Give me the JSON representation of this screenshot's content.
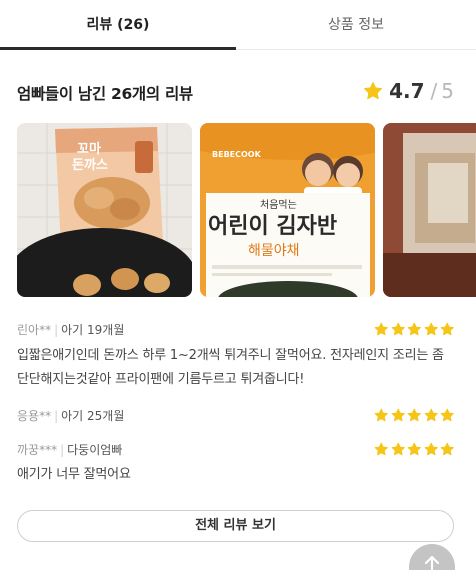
{
  "tabs": {
    "reviews": "리뷰 (26)",
    "product_info": "상품 정보"
  },
  "summary": {
    "heading": "엄빠들이 남긴 26개의 리뷰",
    "score": "4.7",
    "separator": "/",
    "max": "5",
    "star_color": "#f5c518"
  },
  "photos": [
    {
      "label_lines": [
        "꼬마",
        "돈까스"
      ],
      "icon": "photo-thumbnail"
    },
    {
      "brand": "BEBECOOK",
      "subtitle": "처음먹는",
      "title": "어린이 김자반",
      "flavor": "해물야채",
      "icon": "photo-thumbnail"
    },
    {
      "icon": "photo-thumbnail"
    }
  ],
  "reviews": [
    {
      "author": "린아**",
      "age": "아기 19개월",
      "rating": 5,
      "text": "입짧은애기인데 돈까스 하루 1~2개씩 튀겨주니 잘먹어요. 전자레인지 조리는 좀 단단해지는것같아 프라이팬에 기름두르고 튀겨줍니다!"
    },
    {
      "author": "응용**",
      "age": "아기 25개월",
      "rating": 5,
      "text": ""
    },
    {
      "author": "까꿍***",
      "age": "다둥이엄빠",
      "rating": 5,
      "text": "애기가 너무 잘먹어요"
    }
  ],
  "buttons": {
    "all_reviews": "전체 리뷰 보기",
    "scroll_top_icon": "arrow-up-icon"
  }
}
